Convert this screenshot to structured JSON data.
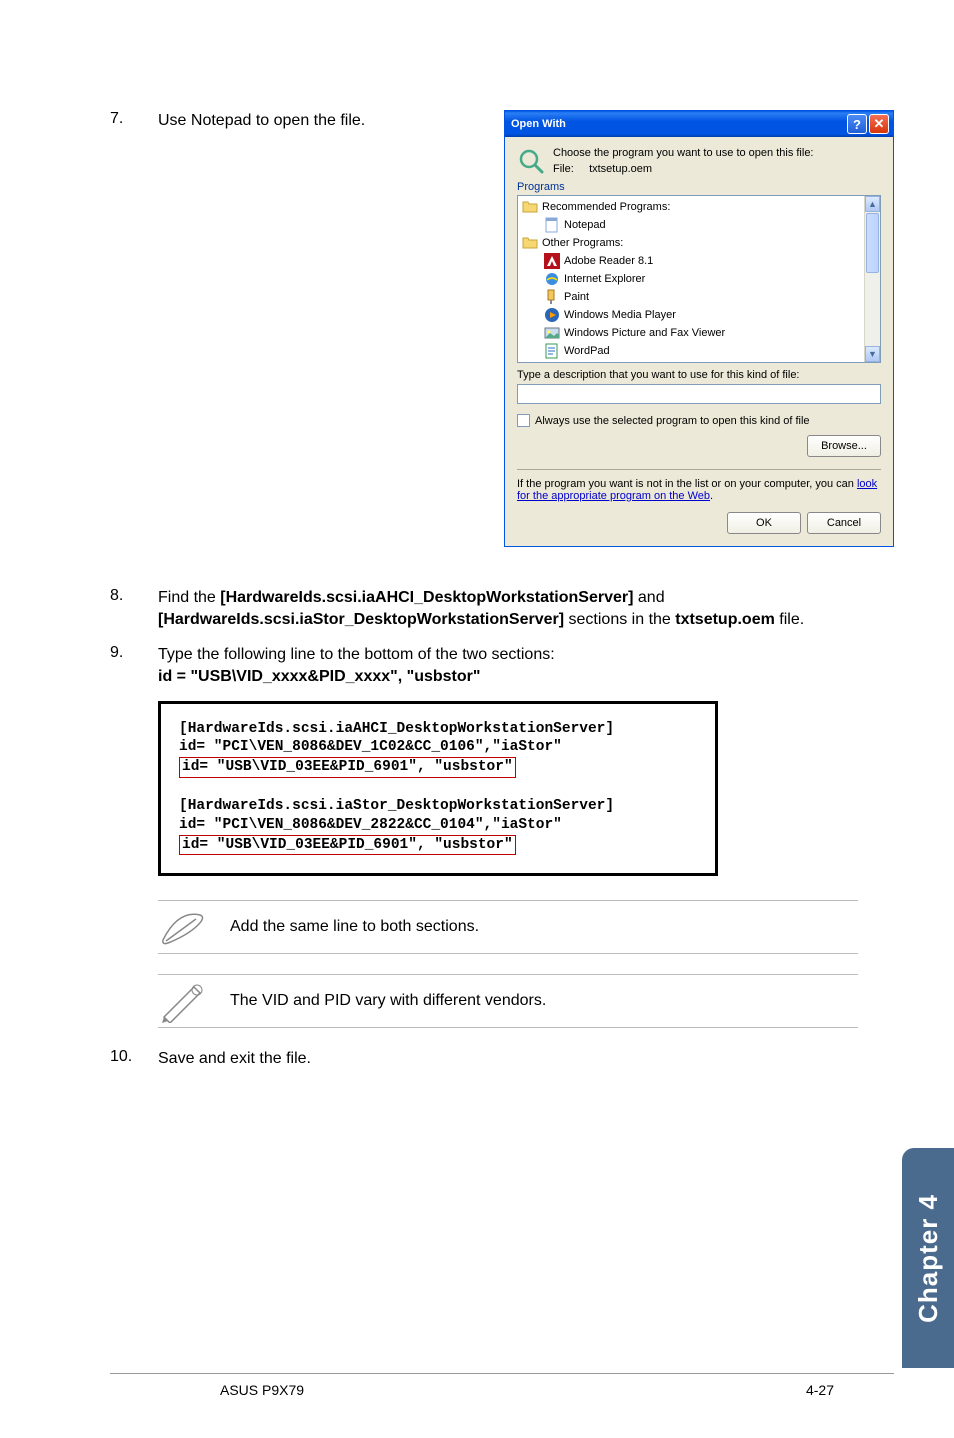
{
  "steps": {
    "s7": {
      "num": "7.",
      "text": "Use Notepad to open the file."
    },
    "s8": {
      "num": "8.",
      "pre": "Find the ",
      "b1": "[HardwareIds.scsi.iaAHCI_DesktopWorkstationServer]",
      "mid": " and ",
      "b2": "[HardwareIds.scsi.iaStor_DesktopWorkstationServer]",
      "mid2": " sections in the ",
      "b3": "txtsetup.oem",
      "post": " file."
    },
    "s9": {
      "num": "9.",
      "line1": "Type the following line to the bottom of the two sections:",
      "line2": "id = \"USB\\VID_xxxx&PID_xxxx\", \"usbstor\""
    },
    "s10": {
      "num": "10.",
      "text": "Save and exit the file."
    }
  },
  "dialog": {
    "title": "Open With",
    "prompt": "Choose the program you want to use to open this file:",
    "file_label": "File:",
    "file_name": "txtsetup.oem",
    "programs_label": "Programs",
    "groups": {
      "recommended": "Recommended Programs:",
      "other": "Other Programs:"
    },
    "items": {
      "notepad": "Notepad",
      "adobe": "Adobe Reader 8.1",
      "ie": "Internet Explorer",
      "paint": "Paint",
      "wmp": "Windows Media Player",
      "wpfv": "Windows Picture and Fax Viewer",
      "wordpad": "WordPad"
    },
    "desc_label": "Type a description that you want to use for this kind of file:",
    "always_label": "Always use the selected program to open this kind of file",
    "browse": "Browse...",
    "web_pre": "If the program you want is not in the list or on your computer, you can ",
    "web_link": "look for the appropriate program on the Web",
    "web_post": ".",
    "ok": "OK",
    "cancel": "Cancel"
  },
  "codebox": {
    "l1": "[HardwareIds.scsi.iaAHCI_DesktopWorkstationServer]",
    "l2": "id= \"PCI\\VEN_8086&DEV_1C02&CC_0106\",\"iaStor\"",
    "l3": "id= \"USB\\VID_03EE&PID_6901\", \"usbstor\"",
    "l4": "[HardwareIds.scsi.iaStor_DesktopWorkstationServer]",
    "l5": "id= \"PCI\\VEN_8086&DEV_2822&CC_0104\",\"iaStor\"",
    "l6": "id= \"USB\\VID_03EE&PID_6901\", \"usbstor\""
  },
  "notes": {
    "n1": "Add the same line to both sections.",
    "n2": "The VID and PID vary with different vendors."
  },
  "sidetab": "Chapter 4",
  "footer": {
    "left": "ASUS P9X79",
    "right": "4-27"
  }
}
